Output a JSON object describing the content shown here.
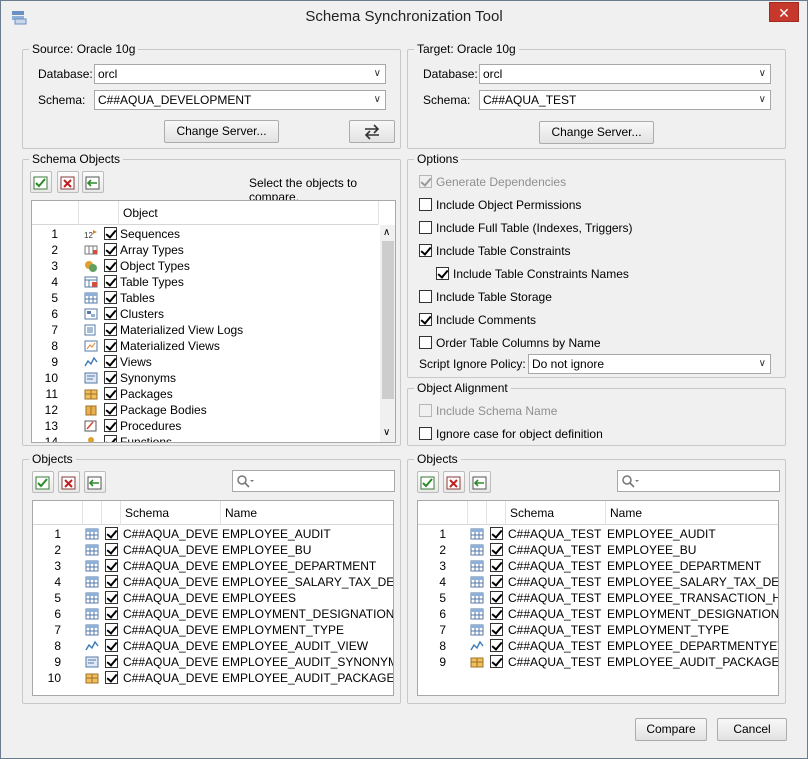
{
  "window": {
    "title": "Schema Synchronization Tool",
    "close": "✕"
  },
  "source": {
    "group_label": "Source: Oracle 10g",
    "database_label": "Database:",
    "database_value": "orcl",
    "schema_label": "Schema:",
    "schema_value": "C##AQUA_DEVELOPMENT",
    "change_server": "Change Server...",
    "swap_icon": "swap-arrows-icon"
  },
  "target": {
    "group_label": "Target: Oracle 10g",
    "database_label": "Database:",
    "database_value": "orcl",
    "schema_label": "Schema:",
    "schema_value": "C##AQUA_TEST",
    "change_server": "Change Server..."
  },
  "schema_objects": {
    "group_label": "Schema Objects",
    "hint": "Select the objects to compare.",
    "column": "Object",
    "items": [
      {
        "n": "1",
        "label": "Sequences",
        "icon": "sequence-icon"
      },
      {
        "n": "2",
        "label": "Array Types",
        "icon": "array-type-icon"
      },
      {
        "n": "3",
        "label": "Object Types",
        "icon": "object-type-icon"
      },
      {
        "n": "4",
        "label": "Table Types",
        "icon": "table-type-icon"
      },
      {
        "n": "5",
        "label": "Tables",
        "icon": "table-icon"
      },
      {
        "n": "6",
        "label": "Clusters",
        "icon": "cluster-icon"
      },
      {
        "n": "7",
        "label": "Materialized View Logs",
        "icon": "mview-log-icon"
      },
      {
        "n": "8",
        "label": "Materialized Views",
        "icon": "mview-icon"
      },
      {
        "n": "9",
        "label": "Views",
        "icon": "view-icon"
      },
      {
        "n": "10",
        "label": "Synonyms",
        "icon": "synonym-icon"
      },
      {
        "n": "11",
        "label": "Packages",
        "icon": "package-icon"
      },
      {
        "n": "12",
        "label": "Package Bodies",
        "icon": "package-body-icon"
      },
      {
        "n": "13",
        "label": "Procedures",
        "icon": "procedure-icon"
      },
      {
        "n": "14",
        "label": "Functions",
        "icon": "function-icon"
      }
    ]
  },
  "options": {
    "group_label": "Options",
    "items": [
      {
        "label": "Generate Dependencies",
        "checked": true,
        "disabled": true
      },
      {
        "label": "Include Object Permissions",
        "checked": false
      },
      {
        "label": "Include Full Table (Indexes, Triggers)",
        "checked": false
      },
      {
        "label": "Include Table Constraints",
        "checked": true
      },
      {
        "label": "Include Table Constraints Names",
        "checked": true
      },
      {
        "label": "Include Table Storage",
        "checked": false
      },
      {
        "label": "Include Comments",
        "checked": true
      },
      {
        "label": "Order Table Columns by Name",
        "checked": false
      }
    ],
    "ignore_label": "Script Ignore Policy:",
    "ignore_value": "Do not ignore"
  },
  "alignment": {
    "group_label": "Object Alignment",
    "include_schema": "Include Schema Name",
    "ignore_case": "Ignore case for object definition"
  },
  "left_objects": {
    "group_label": "Objects",
    "col_schema": "Schema",
    "col_name": "Name",
    "rows": [
      {
        "n": "1",
        "schema": "C##AQUA_DEVE...",
        "name": "EMPLOYEE_AUDIT",
        "icon": "table-icon"
      },
      {
        "n": "2",
        "schema": "C##AQUA_DEVE...",
        "name": "EMPLOYEE_BU",
        "icon": "table-icon"
      },
      {
        "n": "3",
        "schema": "C##AQUA_DEVE...",
        "name": "EMPLOYEE_DEPARTMENT",
        "icon": "table-icon"
      },
      {
        "n": "4",
        "schema": "C##AQUA_DEVE...",
        "name": "EMPLOYEE_SALARY_TAX_DETAILS",
        "icon": "table-icon"
      },
      {
        "n": "5",
        "schema": "C##AQUA_DEVE...",
        "name": "EMPLOYEES",
        "icon": "table-icon"
      },
      {
        "n": "6",
        "schema": "C##AQUA_DEVE...",
        "name": "EMPLOYMENT_DESIGNATION",
        "icon": "table-icon"
      },
      {
        "n": "7",
        "schema": "C##AQUA_DEVE...",
        "name": "EMPLOYMENT_TYPE",
        "icon": "table-icon"
      },
      {
        "n": "8",
        "schema": "C##AQUA_DEVE...",
        "name": "EMPLOYEE_AUDIT_VIEW",
        "icon": "view-icon"
      },
      {
        "n": "9",
        "schema": "C##AQUA_DEVE...",
        "name": "EMPLOYEE_AUDIT_SYNONYM",
        "icon": "synonym-icon"
      },
      {
        "n": "10",
        "schema": "C##AQUA_DEVE...",
        "name": "EMPLOYEE_AUDIT_PACKAGE",
        "icon": "package-icon"
      }
    ]
  },
  "right_objects": {
    "group_label": "Objects",
    "col_schema": "Schema",
    "col_name": "Name",
    "rows": [
      {
        "n": "1",
        "schema": "C##AQUA_TEST",
        "name": "EMPLOYEE_AUDIT",
        "icon": "table-icon"
      },
      {
        "n": "2",
        "schema": "C##AQUA_TEST",
        "name": "EMPLOYEE_BU",
        "icon": "table-icon"
      },
      {
        "n": "3",
        "schema": "C##AQUA_TEST",
        "name": "EMPLOYEE_DEPARTMENT",
        "icon": "table-icon"
      },
      {
        "n": "4",
        "schema": "C##AQUA_TEST",
        "name": "EMPLOYEE_SALARY_TAX_DETAILS",
        "icon": "table-icon"
      },
      {
        "n": "5",
        "schema": "C##AQUA_TEST",
        "name": "EMPLOYEE_TRANSACTION_HIST...",
        "icon": "table-icon"
      },
      {
        "n": "6",
        "schema": "C##AQUA_TEST",
        "name": "EMPLOYMENT_DESIGNATION",
        "icon": "table-icon"
      },
      {
        "n": "7",
        "schema": "C##AQUA_TEST",
        "name": "EMPLOYMENT_TYPE",
        "icon": "table-icon"
      },
      {
        "n": "8",
        "schema": "C##AQUA_TEST",
        "name": "EMPLOYEE_DEPARTMENTYET",
        "icon": "view-icon"
      },
      {
        "n": "9",
        "schema": "C##AQUA_TEST",
        "name": "EMPLOYEE_AUDIT_PACKAGE",
        "icon": "package-icon"
      }
    ]
  },
  "footer": {
    "compare": "Compare",
    "cancel": "Cancel"
  }
}
